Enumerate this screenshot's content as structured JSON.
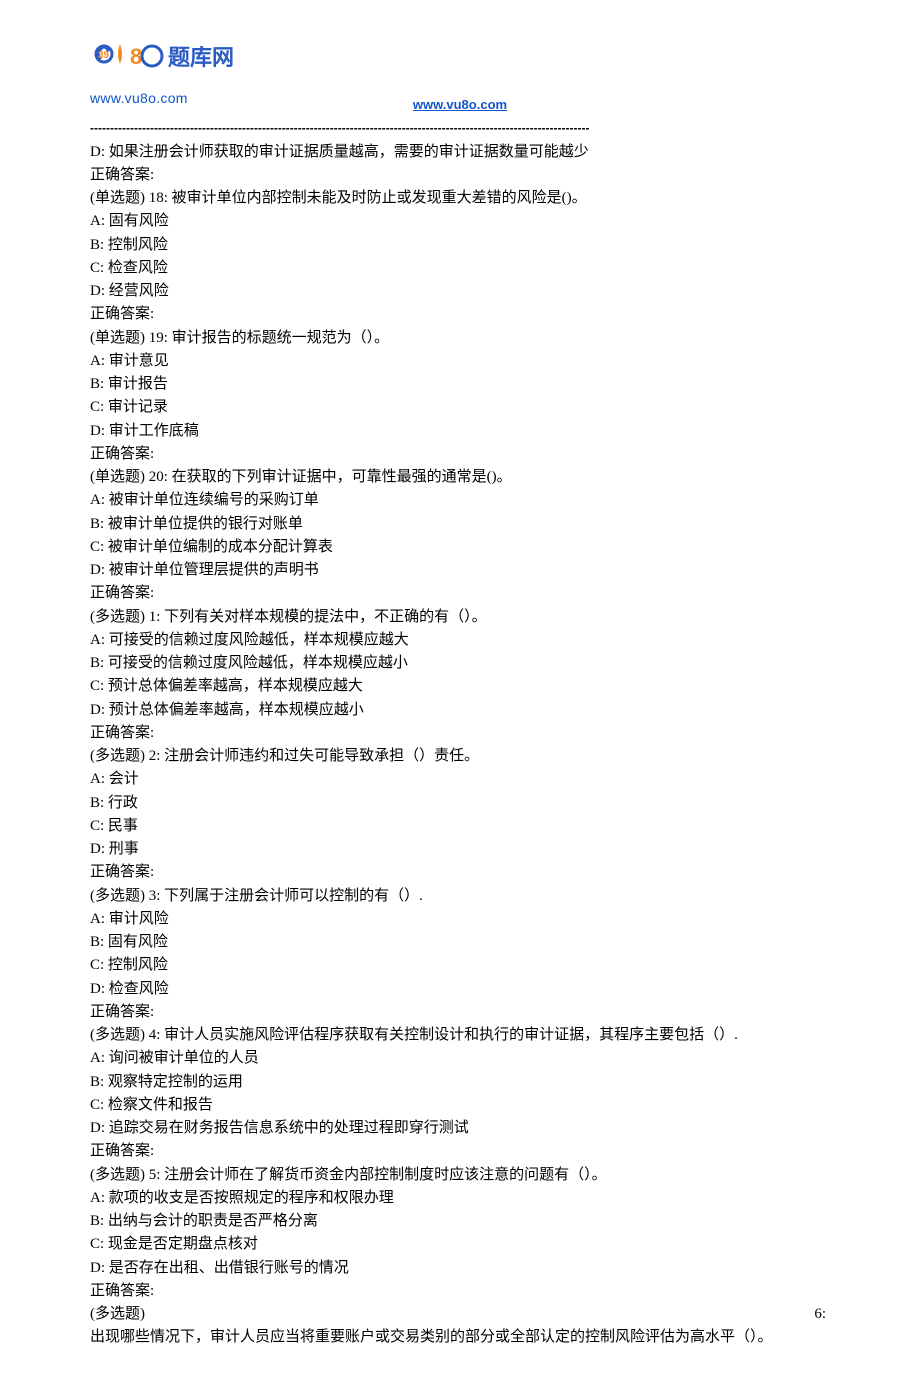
{
  "header": {
    "site_url": "www.vu8o.com",
    "link_text": "www.vu8o.com",
    "divider": "-----------------------------------------------------------------------------------------------------------------------------"
  },
  "lines": [
    "D: 如果注册会计师获取的审计证据质量越高，需要的审计证据数量可能越少",
    "正确答案:",
    "(单选题) 18: 被审计单位内部控制未能及时防止或发现重大差错的风险是()。",
    "A: 固有风险",
    "B: 控制风险",
    "C: 检查风险",
    "D: 经营风险",
    "正确答案:",
    "(单选题) 19: 审计报告的标题统一规范为（）。",
    "A: 审计意见",
    "B: 审计报告",
    "C: 审计记录",
    "D: 审计工作底稿",
    "正确答案:",
    "(单选题) 20: 在获取的下列审计证据中，可靠性最强的通常是()。",
    "A: 被审计单位连续编号的采购订单",
    "B: 被审计单位提供的银行对账单",
    "C: 被审计单位编制的成本分配计算表",
    "D: 被审计单位管理层提供的声明书",
    "正确答案:",
    "(多选题) 1: 下列有关对样本规模的提法中，不正确的有（）。",
    "A: 可接受的信赖过度风险越低，样本规模应越大",
    "B: 可接受的信赖过度风险越低，样本规模应越小",
    "C: 预计总体偏差率越高，样本规模应越大",
    "D: 预计总体偏差率越高，样本规模应越小",
    "正确答案:",
    "(多选题) 2: 注册会计师违约和过失可能导致承担（）责任。",
    "A: 会计",
    "B: 行政",
    "C: 民事",
    "D: 刑事",
    "正确答案:",
    "(多选题) 3: 下列属于注册会计师可以控制的有（）.",
    "A: 审计风险",
    "B: 固有风险",
    "C: 控制风险",
    "D: 检查风险",
    "正确答案:",
    "(多选题) 4: 审计人员实施风险评估程序获取有关控制设计和执行的审计证据，其程序主要包括（）.",
    "A: 询问被审计单位的人员",
    "B: 观察特定控制的运用",
    "C: 检察文件和报告",
    "D: 追踪交易在财务报告信息系统中的处理过程即穿行测试",
    "正确答案:",
    "(多选题) 5: 注册会计师在了解货币资金内部控制制度时应该注意的问题有（）。",
    "A: 款项的收支是否按照规定的程序和权限办理",
    "B: 出纳与会计的职责是否严格分离",
    "C: 现金是否定期盘点核对",
    "D: 是否存在出租、出借银行账号的情况",
    "正确答案:"
  ],
  "split_question": {
    "left": "(多选题)",
    "right": "6:",
    "cont": "出现哪些情况下，审计人员应当将重要账户或交易类别的部分或全部认定的控制风险评估为高水平（）。"
  }
}
